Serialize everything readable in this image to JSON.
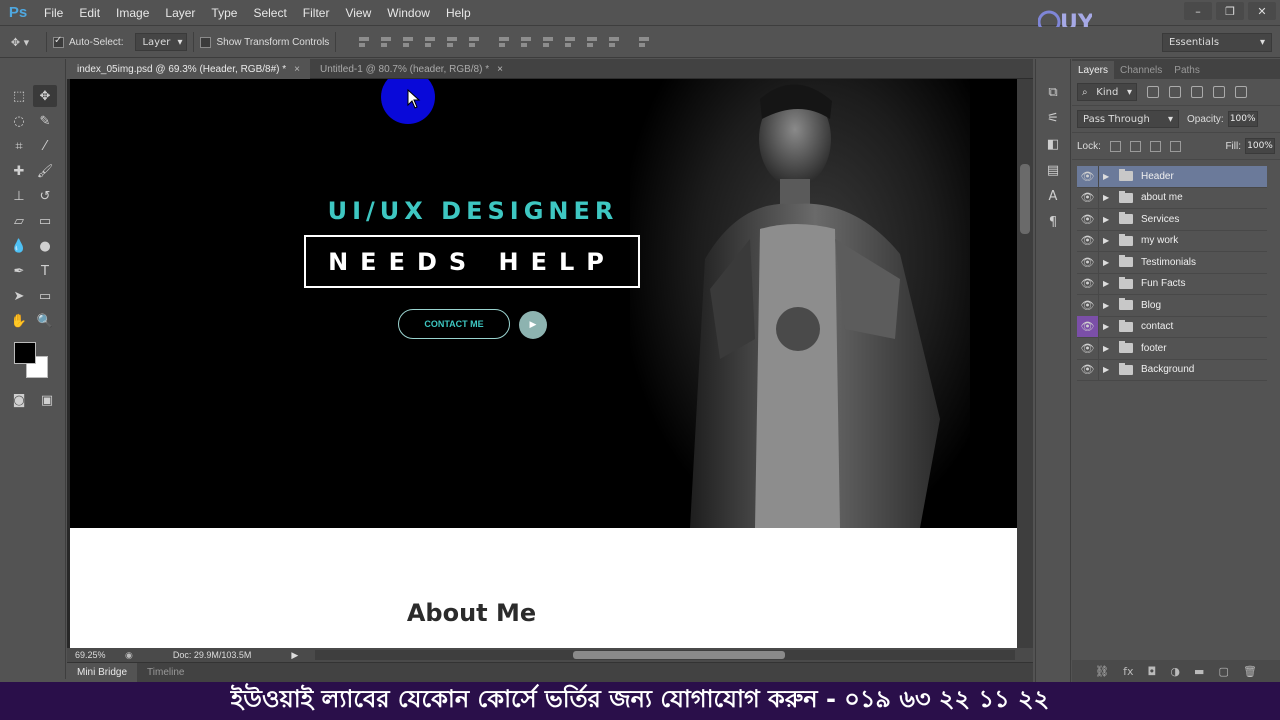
{
  "app": {
    "logo": "Ps"
  },
  "menu": [
    "File",
    "Edit",
    "Image",
    "Layer",
    "Type",
    "Select",
    "Filter",
    "View",
    "Window",
    "Help"
  ],
  "brand_mark": "UY",
  "window_controls": [
    "minimize-icon",
    "restore-icon",
    "close-icon"
  ],
  "options": {
    "auto_select_label": "Auto-Select:",
    "auto_select_checked": true,
    "auto_select_target": "Layer",
    "transform_label": "Show Transform Controls",
    "transform_checked": false,
    "workspace": "Essentials"
  },
  "doc_tabs": [
    {
      "label": "index_05img.psd @ 69.3% (Header, RGB/8#) *",
      "active": true
    },
    {
      "label": "Untitled-1 @ 80.7% (header, RGB/8) *",
      "active": false
    }
  ],
  "canvas": {
    "hero_subtitle": "UI/UX DESIGNER",
    "hero_title": "NEEDS HELP",
    "contact_button": "CONTACT ME",
    "about_title": "About Me",
    "colors": {
      "accent": "#3ec7c2",
      "header_bg": "#000000",
      "about_bg": "#ffffff"
    }
  },
  "status": {
    "zoom": "69.25%",
    "doc_size": "Doc: 29.9M/103.5M"
  },
  "bottom_tabs": [
    "Mini Bridge",
    "Timeline"
  ],
  "layers_panel": {
    "tabs": [
      "Layers",
      "Channels",
      "Paths"
    ],
    "filter_kind": "Kind",
    "blend_mode": "Pass Through",
    "opacity_label": "Opacity:",
    "opacity_value": "100%",
    "lock_label": "Lock:",
    "fill_label": "Fill:",
    "fill_value": "100%",
    "layers": [
      {
        "name": "Header",
        "selected": true,
        "eye_highlight": false
      },
      {
        "name": "about me",
        "selected": false,
        "eye_highlight": false
      },
      {
        "name": "Services",
        "selected": false,
        "eye_highlight": false
      },
      {
        "name": "my work",
        "selected": false,
        "eye_highlight": false
      },
      {
        "name": "Testimonials",
        "selected": false,
        "eye_highlight": false
      },
      {
        "name": "Fun Facts",
        "selected": false,
        "eye_highlight": false
      },
      {
        "name": "Blog",
        "selected": false,
        "eye_highlight": false
      },
      {
        "name": "contact",
        "selected": false,
        "eye_highlight": true
      },
      {
        "name": "footer",
        "selected": false,
        "eye_highlight": false
      },
      {
        "name": "Background",
        "selected": false,
        "eye_highlight": false
      }
    ]
  },
  "caption": "ইউওয়াই ল্যাবের যেকোন কোর্সে ভর্তির জন্য যোগাযোগ করুন - ০১৯ ৬৩ ২২ ১১ ২২"
}
